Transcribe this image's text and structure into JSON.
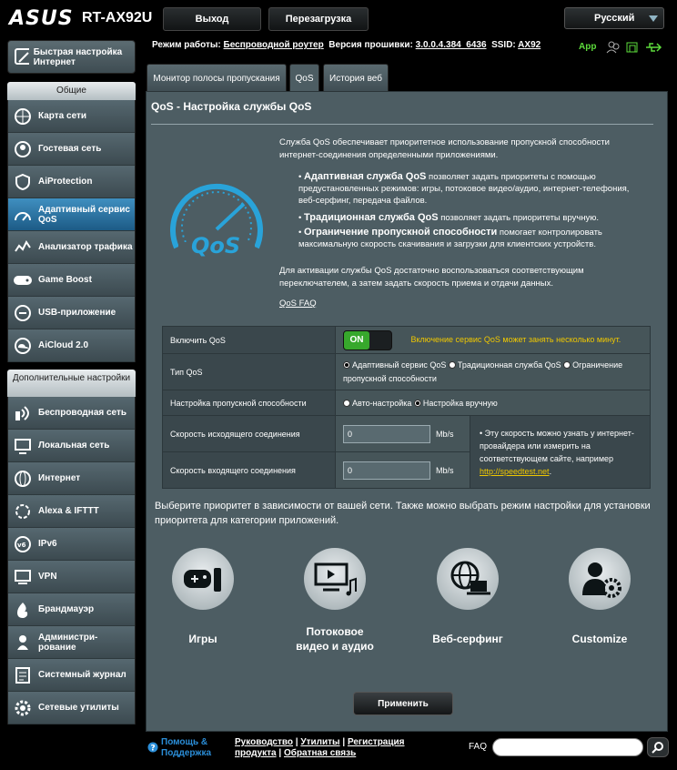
{
  "header": {
    "brand": "ASUS",
    "model": "RT-AX92U",
    "logout": "Выход",
    "reboot": "Перезагрузка",
    "language": "Русский"
  },
  "status": {
    "mode_label": "Режим работы:",
    "mode_value": "Беспроводной роутер",
    "fw_label": "Версия прошивки:",
    "fw_value": "3.0.0.4.384_6436",
    "ssid_label": "SSID:",
    "ssid_value": "AX92",
    "app": "App"
  },
  "sidebar": {
    "quick": "Быстрая настройка Интернет",
    "general_title": "Общие",
    "general": [
      {
        "label": "Карта сети",
        "icon": "network-map-icon"
      },
      {
        "label": "Гостевая сеть",
        "icon": "guest-network-icon"
      },
      {
        "label": "AiProtection",
        "icon": "aiprotection-icon"
      },
      {
        "label": "Адаптивный сервис QoS",
        "icon": "qos-icon"
      },
      {
        "label": "Анализатор трафика",
        "icon": "traffic-analyzer-icon"
      },
      {
        "label": "Game Boost",
        "icon": "game-boost-icon"
      },
      {
        "label": "USB-приложение",
        "icon": "usb-icon"
      },
      {
        "label": "AiCloud 2.0",
        "icon": "aicloud-icon"
      }
    ],
    "advanced_title": "Дополнительные настройки",
    "advanced": [
      {
        "label": "Беспроводная сеть",
        "icon": "wireless-icon"
      },
      {
        "label": "Локальная сеть",
        "icon": "lan-icon"
      },
      {
        "label": "Интернет",
        "icon": "internet-icon"
      },
      {
        "label": "Alexa & IFTTT",
        "icon": "alexa-icon"
      },
      {
        "label": "IPv6",
        "icon": "ipv6-icon"
      },
      {
        "label": "VPN",
        "icon": "vpn-icon"
      },
      {
        "label": "Брандмауэр",
        "icon": "firewall-icon"
      },
      {
        "label": "Администри- рование",
        "icon": "administration-icon"
      },
      {
        "label": "Системный журнал",
        "icon": "system-log-icon"
      },
      {
        "label": "Сетевые утилиты",
        "icon": "network-tools-icon"
      }
    ]
  },
  "tabs": [
    "Монитор полосы пропускания",
    "QoS",
    "История веб"
  ],
  "main": {
    "title": "QoS - Настройка службы QoS",
    "intro": "Служба QoS обеспечивает приоритетное использование пропускной способности интернет-соединения определенными приложениями.",
    "b1_title": "Адаптивная служба QoS",
    "b1_text": " позволяет задать приоритеты с помощью предустановленных режимов: игры, потоковое видео/аудио, интернет-телефония, веб-серфинг, передача файлов.",
    "b2_title": "Традиционная служба QoS",
    "b2_text": " позволяет задать приоритеты вручную.",
    "b3_title": "Ограничение пропускной способности",
    "b3_text": " помогает контролировать максимальную скорость скачивания и загрузки для клиентских устройств.",
    "activate": "Для активации службы QoS достаточно воспользоваться соответствующим переключателем, а затем задать скорость приема и отдачи данных.",
    "faq_link": "QoS FAQ",
    "logo_text": "QoS"
  },
  "settings": {
    "enable_label": "Включить QoS",
    "toggle": "ON",
    "enable_note": "Включение сервис QoS может занять несколько минут.",
    "type_label": "Тип QoS",
    "type_opt1": "Адаптивный сервис QoS",
    "type_opt2": "Традиционная служба QoS",
    "type_opt3": "Ограничение пропускной способности",
    "bw_label": "Настройка пропускной способности",
    "bw_opt1": "Авто-настройка",
    "bw_opt2": "Настройка вручную",
    "up_label": "Скорость исходящего соединения",
    "up_value": "0",
    "up_unit": "Mb/s",
    "down_label": "Скорость входящего соединения",
    "down_value": "0",
    "down_unit": "Mb/s",
    "hint": "Эту скорость можно узнать у интернет-провайдера или измерить на соответствующем сайте, например",
    "hint_link": "http://speedtest.net"
  },
  "priority": {
    "text": "Выберите приоритет в зависимости от вашей сети. Также можно выбрать режим настройки для установки приоритета для категории приложений.",
    "cats": [
      "Игры",
      "Потоковое видео и аудио",
      "Веб-серфинг",
      "Customize"
    ]
  },
  "apply": "Применить",
  "footer": {
    "help": "Помощь & Поддержка",
    "manual": "Руководство",
    "utils": "Утилиты",
    "reg": "Регистрация продукта",
    "feedback": "Обратная связь",
    "faq": "FAQ"
  },
  "colors": {
    "accent": "#2b8ed8",
    "toggle_on": "#37a82c",
    "note": "#f0c800",
    "link": "#f0c800"
  }
}
